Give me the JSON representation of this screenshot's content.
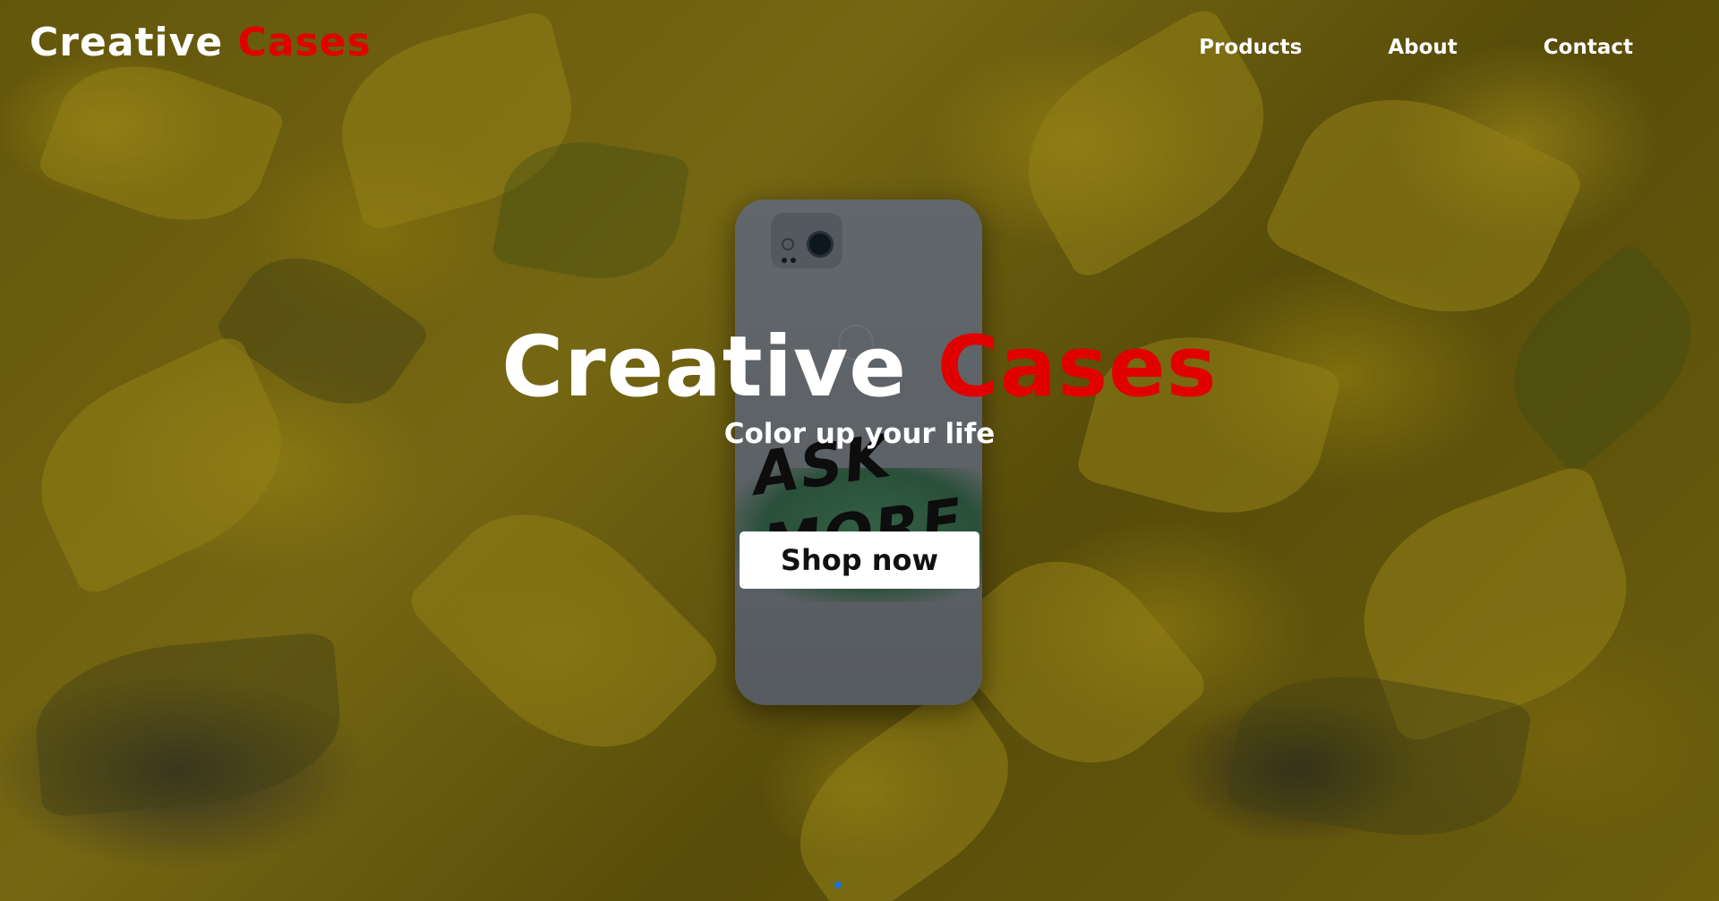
{
  "nav": {
    "logo_part1": "Creative",
    "logo_part2": "Cases",
    "links": [
      "Products",
      "About",
      "Contact"
    ]
  },
  "hero": {
    "title_part1": "Creative",
    "title_part2": "Cases",
    "tagline": "Color up your life",
    "cta_label": "Shop now",
    "phone_case_text": "ASK MORE"
  },
  "colors": {
    "accent": "#e00000",
    "text": "#ffffff",
    "button_bg": "#ffffff",
    "carousel_dot": "#1e74d6"
  },
  "carousel": {
    "active_index": 1,
    "total": 1
  }
}
